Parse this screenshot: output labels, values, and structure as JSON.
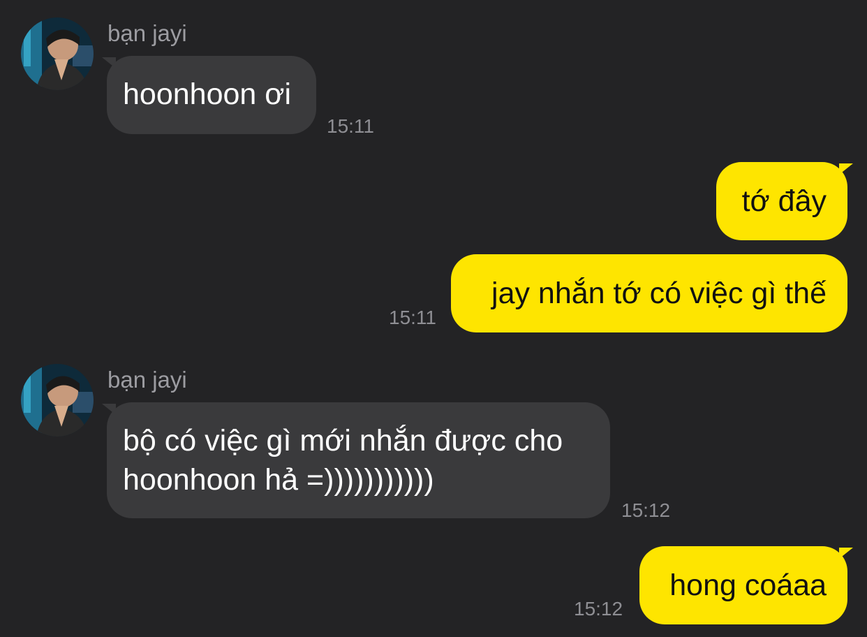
{
  "messages": [
    {
      "direction": "incoming",
      "sender": "bạn jayi",
      "lines": [
        "hoonhoon ơi"
      ],
      "time": "15:11"
    },
    {
      "direction": "outgoing",
      "lines": [
        "tớ đây"
      ],
      "time": ""
    },
    {
      "direction": "outgoing",
      "lines": [
        "jay nhắn tớ có việc gì thế"
      ],
      "time": "15:11"
    },
    {
      "direction": "incoming",
      "sender": "bạn jayi",
      "lines": [
        "bộ có việc gì mới nhắn được cho",
        "hoonhoon hả =)))))))))))"
      ],
      "time": "15:12"
    },
    {
      "direction": "outgoing",
      "lines": [
        "hong coáaa"
      ],
      "time": "15:12"
    }
  ],
  "colors": {
    "background": "#232325",
    "incoming_bubble": "#3a3a3c",
    "outgoing_bubble": "#fee500",
    "incoming_text": "#ffffff",
    "outgoing_text": "#111111",
    "secondary_text": "#8e8e93"
  }
}
